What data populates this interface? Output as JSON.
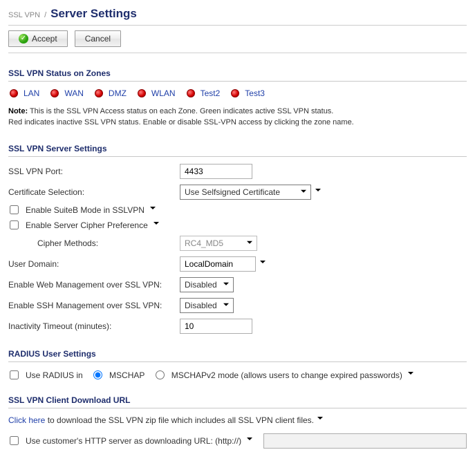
{
  "breadcrumb": {
    "parent": "SSL VPN",
    "title": "Server Settings"
  },
  "buttons": {
    "accept": "Accept",
    "cancel": "Cancel"
  },
  "zones_section": {
    "title": "SSL VPN Status on Zones",
    "zones": [
      "LAN",
      "WAN",
      "DMZ",
      "WLAN",
      "Test2",
      "Test3"
    ],
    "note_bold": "Note:",
    "note_line1": " This is the SSL VPN Access status on each Zone. Green indicates active SSL VPN status.",
    "note_line2": "Red indicates inactive SSL VPN status. Enable or disable SSL-VPN access by clicking the zone name."
  },
  "server_section": {
    "title": "SSL VPN Server Settings",
    "port_label": "SSL VPN Port:",
    "port_value": "4433",
    "cert_label": "Certificate Selection:",
    "cert_value": "Use Selfsigned Certificate",
    "suiteb_label": "Enable SuiteB Mode in SSLVPN",
    "cipherpref_label": "Enable Server Cipher Preference",
    "cipher_methods_label": "Cipher Methods:",
    "cipher_methods_value": "RC4_MD5",
    "domain_label": "User Domain:",
    "domain_value": "LocalDomain",
    "web_mgmt_label": "Enable Web Management over SSL VPN:",
    "web_mgmt_value": "Disabled",
    "ssh_mgmt_label": "Enable SSH Management over SSL VPN:",
    "ssh_mgmt_value": "Disabled",
    "timeout_label": "Inactivity Timeout (minutes):",
    "timeout_value": "10"
  },
  "radius_section": {
    "title": "RADIUS User Settings",
    "use_radius_label": "Use RADIUS in",
    "opt_mschap": "MSCHAP",
    "opt_mschapv2": "MSCHAPv2 mode (allows users to change expired passwords)"
  },
  "download_section": {
    "title": "SSL VPN Client Download URL",
    "click_here": "Click here",
    "dl_text": " to download the SSL VPN zip file which includes all SSL VPN client files.",
    "cust_http_label": "Use customer's HTTP server as downloading URL: (http://)"
  }
}
